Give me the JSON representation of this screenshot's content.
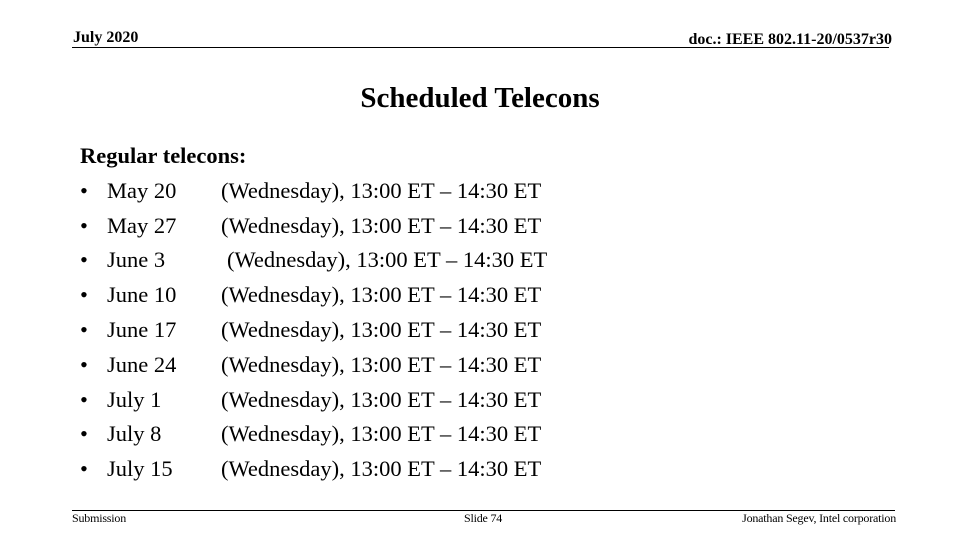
{
  "header": {
    "date": "July 2020",
    "doc_id": "doc.: IEEE 802.11-20/0537r30"
  },
  "title": "Scheduled Telecons",
  "content": {
    "subheading": "Regular telecons:",
    "bullet_glyph": "•",
    "items": [
      {
        "date": "May 20",
        "detail": "(Wednesday), 13:00 ET – 14:30 ET"
      },
      {
        "date": "May 27",
        "detail": "(Wednesday), 13:00 ET – 14:30 ET"
      },
      {
        "date": "June 3",
        "detail": "(Wednesday), 13:00 ET – 14:30 ET"
      },
      {
        "date": "June 10",
        "detail": "(Wednesday), 13:00 ET – 14:30 ET"
      },
      {
        "date": "June 17",
        "detail": "(Wednesday), 13:00 ET – 14:30 ET"
      },
      {
        "date": "June 24",
        "detail": "(Wednesday), 13:00 ET – 14:30 ET"
      },
      {
        "date": "July 1",
        "detail": "(Wednesday), 13:00 ET – 14:30 ET"
      },
      {
        "date": "July 8",
        "detail": "(Wednesday), 13:00 ET – 14:30 ET"
      },
      {
        "date": "July 15",
        "detail": "(Wednesday), 13:00 ET – 14:30 ET"
      }
    ]
  },
  "footer": {
    "left": "Submission",
    "center": "Slide 74",
    "right": "Jonathan Segev, Intel corporation"
  }
}
